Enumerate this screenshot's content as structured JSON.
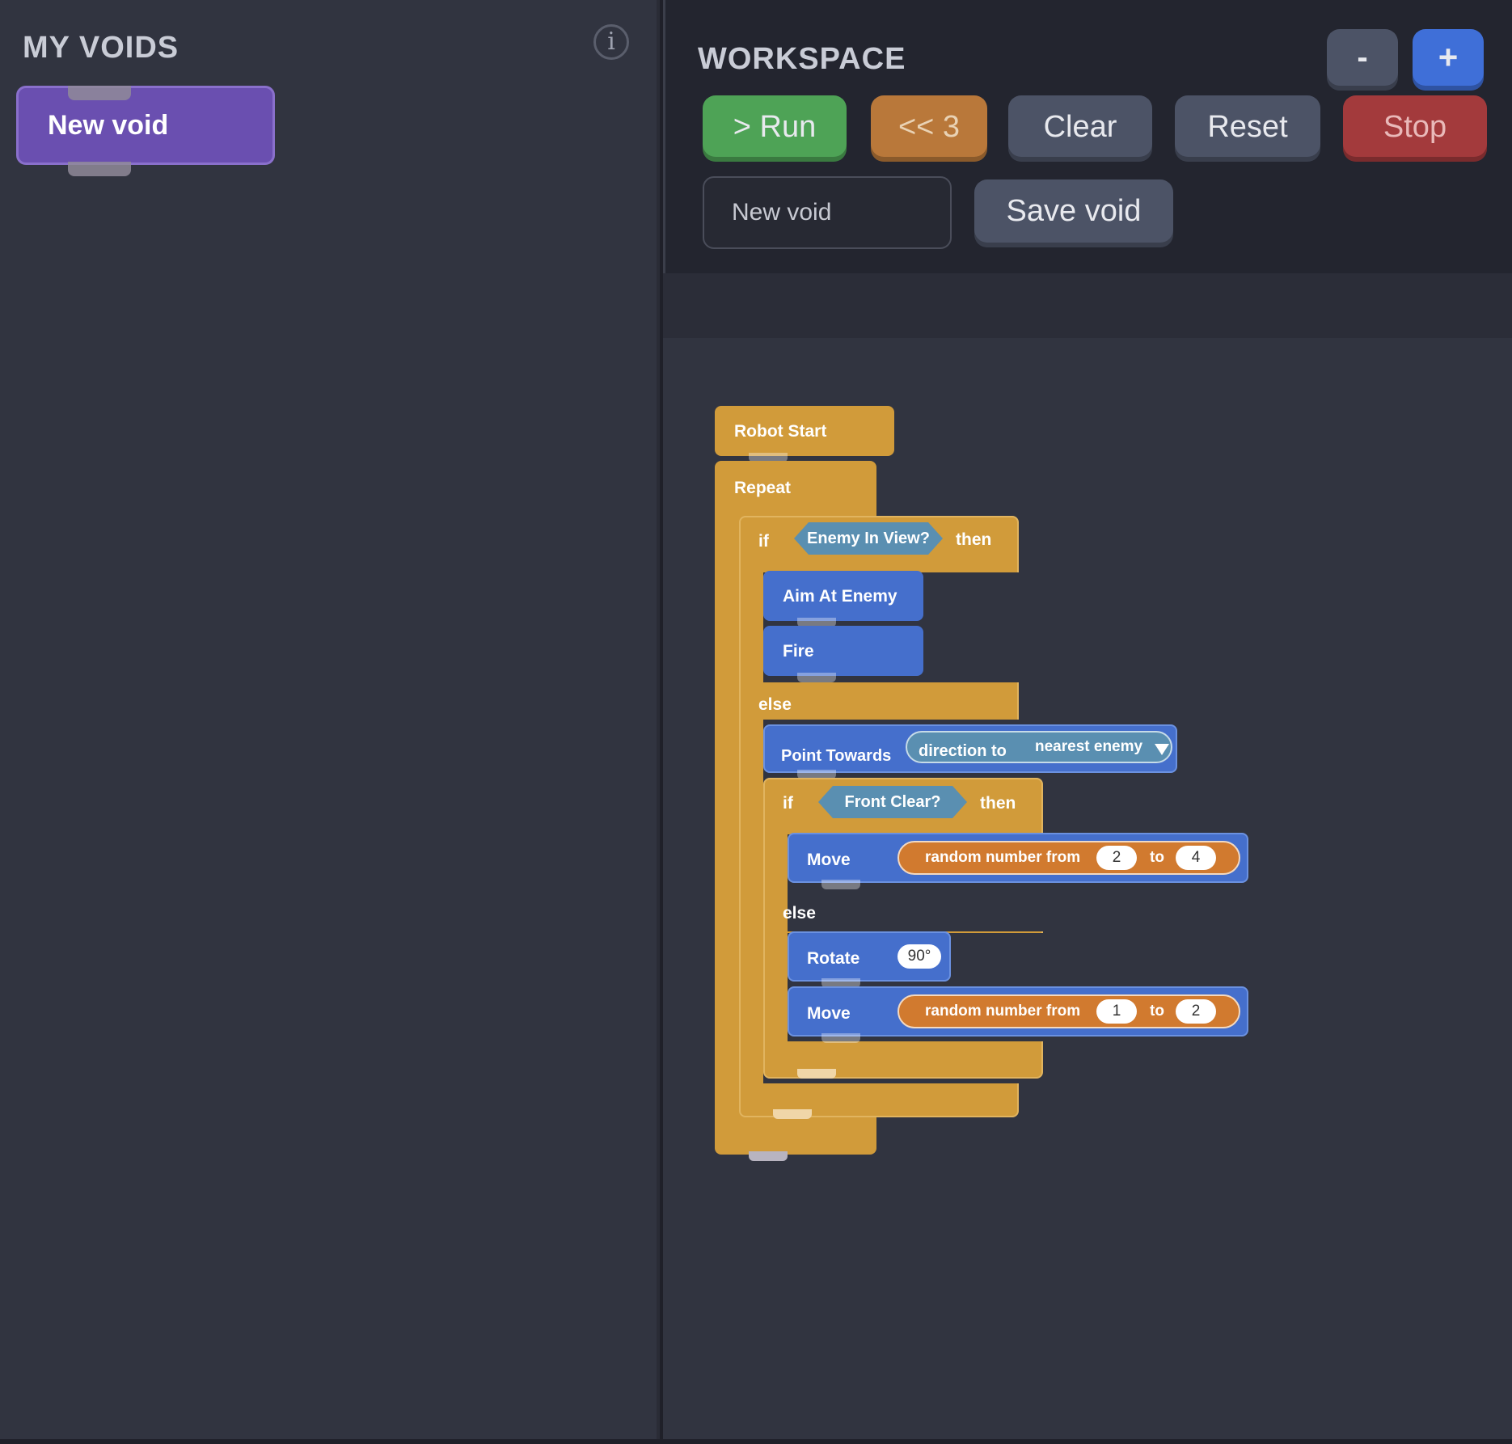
{
  "left_panel": {
    "title": "MY VOIDS",
    "info_icon": "i",
    "void_block": "New void"
  },
  "workspace": {
    "title": "WORKSPACE",
    "zoom_out": "-",
    "zoom_in": "+",
    "buttons": {
      "run": "> Run",
      "back": "<< 3",
      "clear": "Clear",
      "reset": "Reset",
      "stop": "Stop",
      "save": "Save void"
    },
    "name_input": {
      "value": "New void",
      "placeholder": "New void"
    },
    "colors": {
      "run": "#4ea356",
      "back": "#b9783a",
      "neutral": "#4c5366",
      "stop": "#a33a3c",
      "zoom_in": "#3f6fd8"
    }
  },
  "program": {
    "robot_start": "Robot Start",
    "repeat": "Repeat",
    "if1": {
      "if": "if",
      "condition": "Enemy In View?",
      "then": "then"
    },
    "aim": "Aim At Enemy",
    "fire": "Fire",
    "else1": "else",
    "point": {
      "label": "Point Towards",
      "direction": "direction to",
      "target": "nearest enemy"
    },
    "if2": {
      "if": "if",
      "condition": "Front Clear?",
      "then": "then"
    },
    "move1": {
      "label": "Move",
      "random": "random number from",
      "from": "2",
      "to_label": "to",
      "to": "4"
    },
    "else2": "else",
    "rotate": {
      "label": "Rotate",
      "value": "90°"
    },
    "move2": {
      "label": "Move",
      "random": "random number from",
      "from": "1",
      "to_label": "to",
      "to": "2"
    },
    "colors": {
      "control": "#d19b3a",
      "action": "#456fcc",
      "sensor": "#5a8fb1",
      "operator": "#d17a2f"
    }
  }
}
